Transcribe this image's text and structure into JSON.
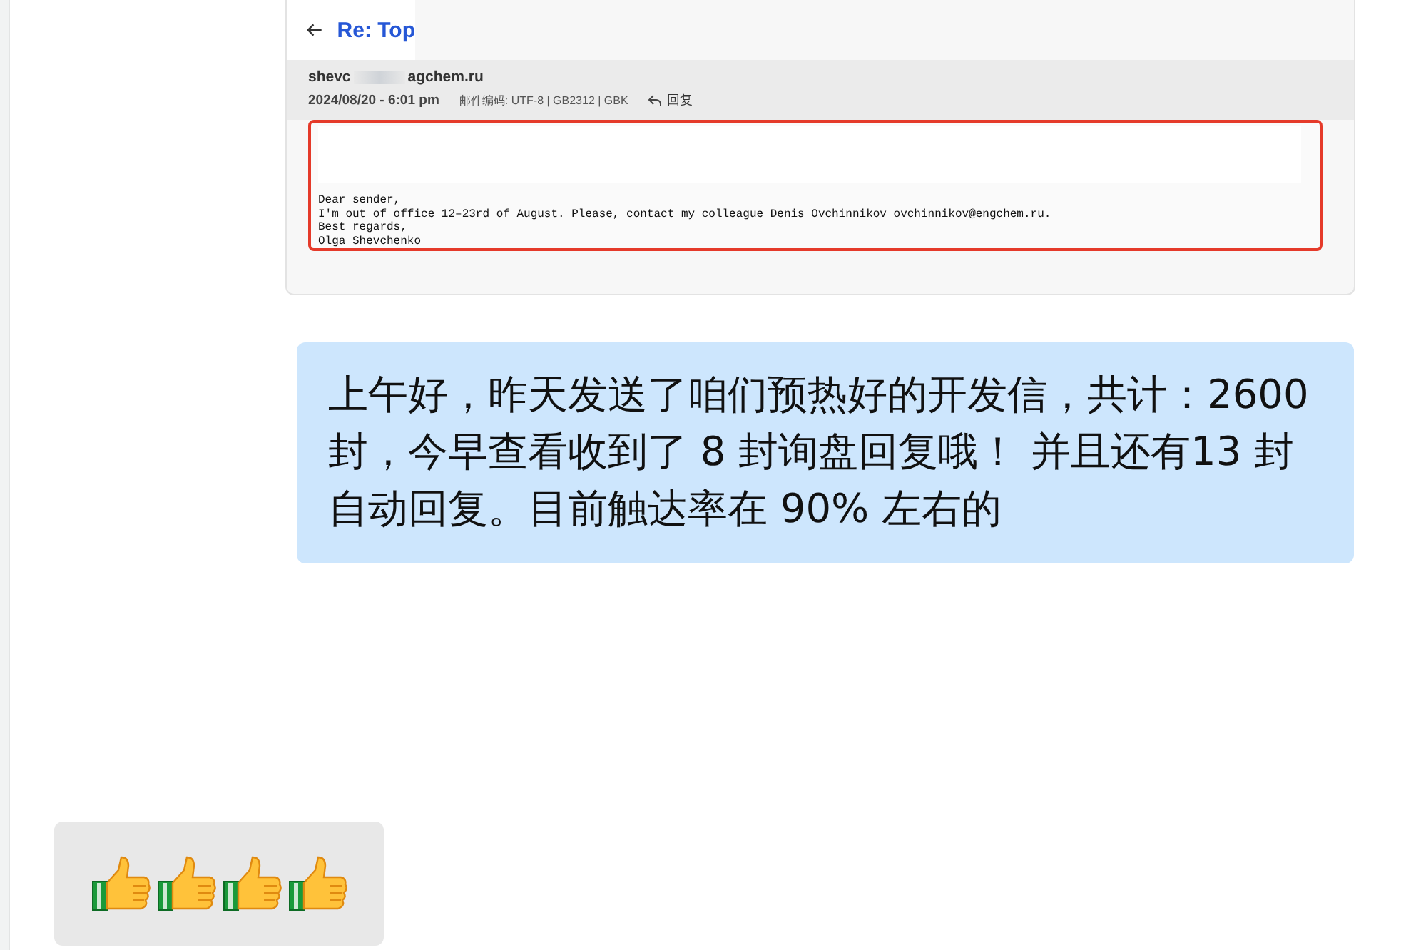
{
  "email_screenshot": {
    "subject": "Re: Top",
    "sender_start": "shevc",
    "sender_end": "agchem.ru",
    "date": "2024/08/20 - 6:01 pm",
    "encoding": "邮件编码: UTF-8 | GB2312 | GBK",
    "reply": "回复",
    "body_lines": [
      "Dear sender,",
      "I'm out of office 12–23rd of August. Please, contact my colleague Denis Ovchinnikov ovchinnikov@engchem.ru.",
      "Best regards,",
      "Olga Shevchenko"
    ]
  },
  "messages": [
    {
      "kind": "text",
      "text": "上午好，昨天发送了咱们预热好的开发信，共计：2600封，今早查看收到了 8 封询盘回复哦！ 并且还有13 封自动回复。目前触达率在 90% 左右的"
    },
    {
      "kind": "emoji",
      "emojis": [
        {
          "kind": "thumbs_up"
        },
        {
          "kind": "thumbs_up"
        },
        {
          "kind": "thumbs_up"
        },
        {
          "kind": "thumbs_up"
        }
      ]
    }
  ]
}
